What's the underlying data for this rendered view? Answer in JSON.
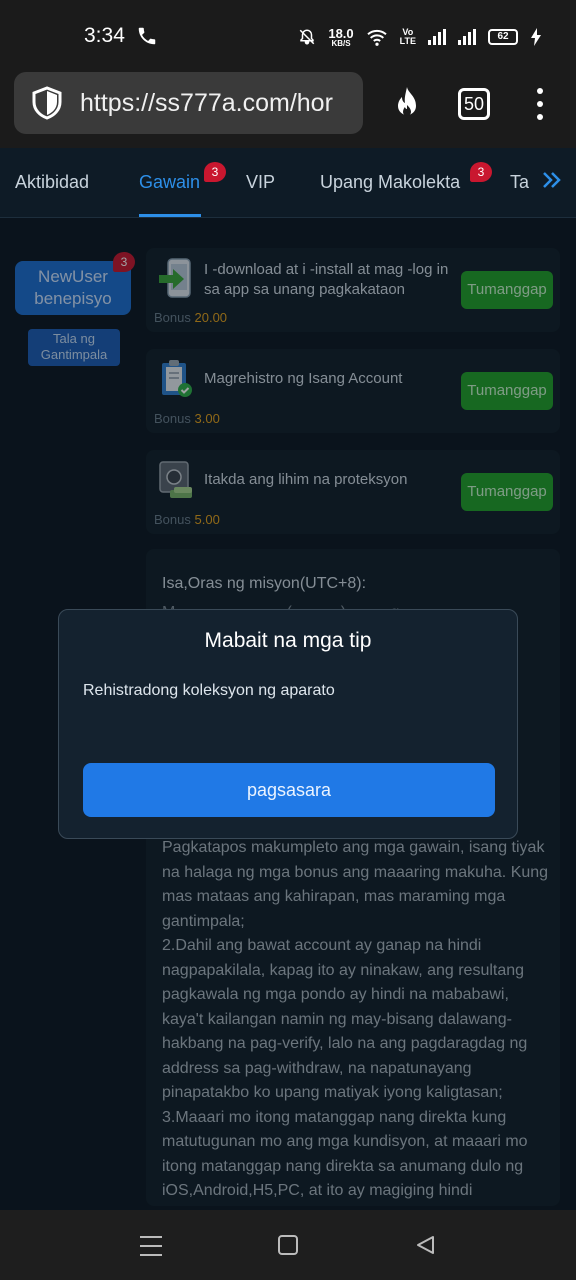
{
  "status_bar": {
    "time": "3:34",
    "net_speed": "18.0",
    "net_speed_unit": "KB/S",
    "volte_top": "Vo",
    "volte_bottom": "LTE",
    "battery": "62"
  },
  "browser": {
    "url": "https://ss777a.com/hor",
    "tab_count": "50"
  },
  "tabs": [
    {
      "label": "Aktibidad"
    },
    {
      "label": "Gawain",
      "badge": "3"
    },
    {
      "label": "VIP"
    },
    {
      "label": "Upang Makolekta",
      "badge": "3"
    },
    {
      "label": "Ta"
    }
  ],
  "sidebar": {
    "newuser_line1": "NewUser",
    "newuser_line2": "benepisyo",
    "newuser_badge": "3",
    "rewards_line1": "Tala ng",
    "rewards_line2": "Gantimpala"
  },
  "tasks": [
    {
      "title": "I -download at i -install at mag -log in sa app sa unang pagkakataon",
      "bonus_label": "Bonus",
      "bonus_value": "20.00",
      "button": "Tumanggap",
      "icon": "download-app-icon"
    },
    {
      "title": "Magrehistro ng Isang Account",
      "bonus_label": "Bonus",
      "bonus_value": "3.00",
      "button": "Tumanggap",
      "icon": "register-account-icon"
    },
    {
      "title": "Itakda ang lihim na proteksyon",
      "bonus_label": "Bonus",
      "bonus_value": "5.00",
      "button": "Tumanggap",
      "icon": "safe-icon"
    }
  ],
  "info": {
    "heading": "Isa,Oras ng misyon(UTC+8):",
    "body": "Pagkatapos makumpleto ang mga gawain, isang tiyak na halaga ng mga bonus ang maaaring makuha. Kung mas mataas ang kahirapan, mas maraming mga gantimpala;\n2.Dahil ang bawat account ay ganap na hindi nagpapakilala, kapag ito ay ninakaw, ang resultang pagkawala ng mga pondo ay hindi na mababawi, kaya't kailangan namin ng may-bisang dalawang-hakbang na pag-verify, lalo na ang pagdaragdag ng address sa pag-withdraw, na napatunayang pinapatakbo ko upang matiyak iyong kaligtasan;\n3.Maaari mo itong matanggap nang direkta kung matutugunan mo ang mga kundisyon, at maaari mo itong matanggap nang direkta sa anumang dulo ng iOS,Android,H5,PC, at ito ay magiging hindi"
  },
  "modal": {
    "title": "Mabait na mga tip",
    "message": "Rehistradong koleksyon ng aparato",
    "button": "pagsasara"
  },
  "colors": {
    "accent": "#2d8fe8",
    "claim_green": "#23a02a",
    "badge_red": "#c9172f",
    "bonus_orange": "#e5a21c"
  }
}
